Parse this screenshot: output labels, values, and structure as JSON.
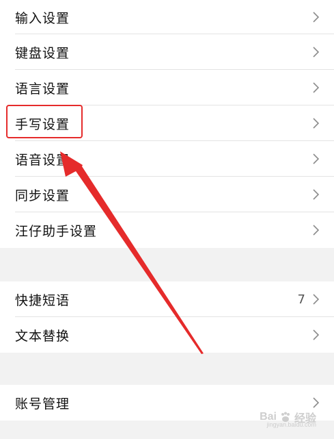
{
  "settings_group_1": {
    "items": [
      {
        "label": "输入设置"
      },
      {
        "label": "键盘设置"
      },
      {
        "label": "语言设置"
      },
      {
        "label": "手写设置"
      },
      {
        "label": "语音设置"
      },
      {
        "label": "同步设置"
      },
      {
        "label": "汪仔助手设置"
      }
    ]
  },
  "settings_group_2": {
    "items": [
      {
        "label": "快捷短语",
        "value": "7"
      },
      {
        "label": "文本替换"
      }
    ]
  },
  "settings_group_3": {
    "items": [
      {
        "label": "账号管理"
      }
    ]
  },
  "annotation": {
    "color": "#e52b2b",
    "highlighted_item": "手写设置"
  },
  "watermark": {
    "brand": "Bai",
    "brand_suffix": "经验",
    "subtitle": "jingyan.baidu.com",
    "color": "#c9c9c9"
  },
  "icons": {
    "row_chevron": "chevron-right-icon",
    "watermark": "baidu-paw-icon"
  }
}
